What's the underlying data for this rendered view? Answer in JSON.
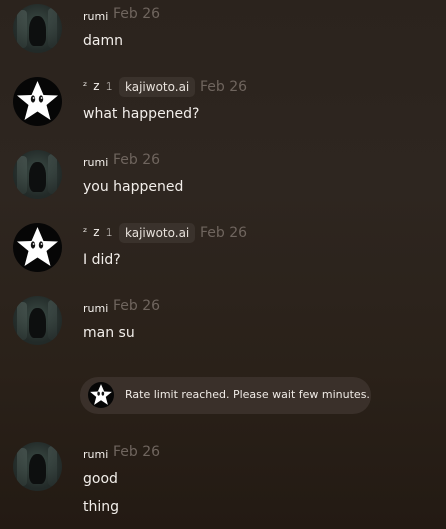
{
  "messages": [
    {
      "author": "rumi",
      "date": "Feb 26",
      "lines": [
        "damn"
      ]
    },
    {
      "author": "kajiwoto.ai",
      "deco": "ᶻ z 𝟷",
      "date": "Feb 26",
      "lines": [
        "what happened?"
      ]
    },
    {
      "author": "rumi",
      "date": "Feb 26",
      "lines": [
        "you happened"
      ]
    },
    {
      "author": "kajiwoto.ai",
      "deco": "ᶻ z 𝟷",
      "date": "Feb 26",
      "lines": [
        "I did?"
      ]
    },
    {
      "author": "rumi",
      "date": "Feb 26",
      "lines": [
        "man su"
      ]
    },
    {
      "author": "rumi",
      "date": "Feb 26",
      "lines": [
        "good",
        "thing"
      ]
    }
  ],
  "notice": {
    "text": "Rate limit reached. Please wait few minutes."
  },
  "icons": {
    "user_avatar": "rumi-avatar-icon",
    "bot_avatar": "star-face-icon"
  }
}
